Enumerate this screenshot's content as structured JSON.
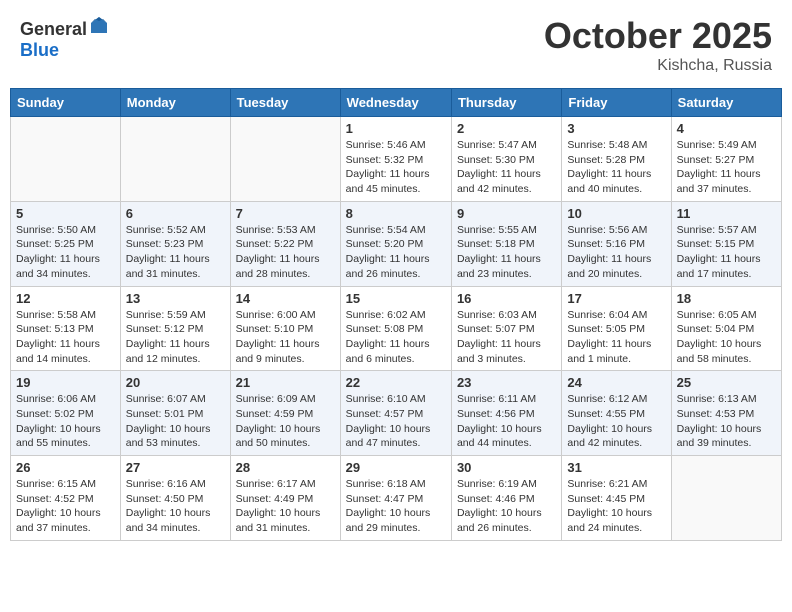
{
  "header": {
    "logo_general": "General",
    "logo_blue": "Blue",
    "month_title": "October 2025",
    "location": "Kishcha, Russia"
  },
  "columns": [
    "Sunday",
    "Monday",
    "Tuesday",
    "Wednesday",
    "Thursday",
    "Friday",
    "Saturday"
  ],
  "weeks": [
    [
      {
        "day": "",
        "sunrise": "",
        "sunset": "",
        "daylight": ""
      },
      {
        "day": "",
        "sunrise": "",
        "sunset": "",
        "daylight": ""
      },
      {
        "day": "",
        "sunrise": "",
        "sunset": "",
        "daylight": ""
      },
      {
        "day": "1",
        "sunrise": "Sunrise: 5:46 AM",
        "sunset": "Sunset: 5:32 PM",
        "daylight": "Daylight: 11 hours and 45 minutes."
      },
      {
        "day": "2",
        "sunrise": "Sunrise: 5:47 AM",
        "sunset": "Sunset: 5:30 PM",
        "daylight": "Daylight: 11 hours and 42 minutes."
      },
      {
        "day": "3",
        "sunrise": "Sunrise: 5:48 AM",
        "sunset": "Sunset: 5:28 PM",
        "daylight": "Daylight: 11 hours and 40 minutes."
      },
      {
        "day": "4",
        "sunrise": "Sunrise: 5:49 AM",
        "sunset": "Sunset: 5:27 PM",
        "daylight": "Daylight: 11 hours and 37 minutes."
      }
    ],
    [
      {
        "day": "5",
        "sunrise": "Sunrise: 5:50 AM",
        "sunset": "Sunset: 5:25 PM",
        "daylight": "Daylight: 11 hours and 34 minutes."
      },
      {
        "day": "6",
        "sunrise": "Sunrise: 5:52 AM",
        "sunset": "Sunset: 5:23 PM",
        "daylight": "Daylight: 11 hours and 31 minutes."
      },
      {
        "day": "7",
        "sunrise": "Sunrise: 5:53 AM",
        "sunset": "Sunset: 5:22 PM",
        "daylight": "Daylight: 11 hours and 28 minutes."
      },
      {
        "day": "8",
        "sunrise": "Sunrise: 5:54 AM",
        "sunset": "Sunset: 5:20 PM",
        "daylight": "Daylight: 11 hours and 26 minutes."
      },
      {
        "day": "9",
        "sunrise": "Sunrise: 5:55 AM",
        "sunset": "Sunset: 5:18 PM",
        "daylight": "Daylight: 11 hours and 23 minutes."
      },
      {
        "day": "10",
        "sunrise": "Sunrise: 5:56 AM",
        "sunset": "Sunset: 5:16 PM",
        "daylight": "Daylight: 11 hours and 20 minutes."
      },
      {
        "day": "11",
        "sunrise": "Sunrise: 5:57 AM",
        "sunset": "Sunset: 5:15 PM",
        "daylight": "Daylight: 11 hours and 17 minutes."
      }
    ],
    [
      {
        "day": "12",
        "sunrise": "Sunrise: 5:58 AM",
        "sunset": "Sunset: 5:13 PM",
        "daylight": "Daylight: 11 hours and 14 minutes."
      },
      {
        "day": "13",
        "sunrise": "Sunrise: 5:59 AM",
        "sunset": "Sunset: 5:12 PM",
        "daylight": "Daylight: 11 hours and 12 minutes."
      },
      {
        "day": "14",
        "sunrise": "Sunrise: 6:00 AM",
        "sunset": "Sunset: 5:10 PM",
        "daylight": "Daylight: 11 hours and 9 minutes."
      },
      {
        "day": "15",
        "sunrise": "Sunrise: 6:02 AM",
        "sunset": "Sunset: 5:08 PM",
        "daylight": "Daylight: 11 hours and 6 minutes."
      },
      {
        "day": "16",
        "sunrise": "Sunrise: 6:03 AM",
        "sunset": "Sunset: 5:07 PM",
        "daylight": "Daylight: 11 hours and 3 minutes."
      },
      {
        "day": "17",
        "sunrise": "Sunrise: 6:04 AM",
        "sunset": "Sunset: 5:05 PM",
        "daylight": "Daylight: 11 hours and 1 minute."
      },
      {
        "day": "18",
        "sunrise": "Sunrise: 6:05 AM",
        "sunset": "Sunset: 5:04 PM",
        "daylight": "Daylight: 10 hours and 58 minutes."
      }
    ],
    [
      {
        "day": "19",
        "sunrise": "Sunrise: 6:06 AM",
        "sunset": "Sunset: 5:02 PM",
        "daylight": "Daylight: 10 hours and 55 minutes."
      },
      {
        "day": "20",
        "sunrise": "Sunrise: 6:07 AM",
        "sunset": "Sunset: 5:01 PM",
        "daylight": "Daylight: 10 hours and 53 minutes."
      },
      {
        "day": "21",
        "sunrise": "Sunrise: 6:09 AM",
        "sunset": "Sunset: 4:59 PM",
        "daylight": "Daylight: 10 hours and 50 minutes."
      },
      {
        "day": "22",
        "sunrise": "Sunrise: 6:10 AM",
        "sunset": "Sunset: 4:57 PM",
        "daylight": "Daylight: 10 hours and 47 minutes."
      },
      {
        "day": "23",
        "sunrise": "Sunrise: 6:11 AM",
        "sunset": "Sunset: 4:56 PM",
        "daylight": "Daylight: 10 hours and 44 minutes."
      },
      {
        "day": "24",
        "sunrise": "Sunrise: 6:12 AM",
        "sunset": "Sunset: 4:55 PM",
        "daylight": "Daylight: 10 hours and 42 minutes."
      },
      {
        "day": "25",
        "sunrise": "Sunrise: 6:13 AM",
        "sunset": "Sunset: 4:53 PM",
        "daylight": "Daylight: 10 hours and 39 minutes."
      }
    ],
    [
      {
        "day": "26",
        "sunrise": "Sunrise: 6:15 AM",
        "sunset": "Sunset: 4:52 PM",
        "daylight": "Daylight: 10 hours and 37 minutes."
      },
      {
        "day": "27",
        "sunrise": "Sunrise: 6:16 AM",
        "sunset": "Sunset: 4:50 PM",
        "daylight": "Daylight: 10 hours and 34 minutes."
      },
      {
        "day": "28",
        "sunrise": "Sunrise: 6:17 AM",
        "sunset": "Sunset: 4:49 PM",
        "daylight": "Daylight: 10 hours and 31 minutes."
      },
      {
        "day": "29",
        "sunrise": "Sunrise: 6:18 AM",
        "sunset": "Sunset: 4:47 PM",
        "daylight": "Daylight: 10 hours and 29 minutes."
      },
      {
        "day": "30",
        "sunrise": "Sunrise: 6:19 AM",
        "sunset": "Sunset: 4:46 PM",
        "daylight": "Daylight: 10 hours and 26 minutes."
      },
      {
        "day": "31",
        "sunrise": "Sunrise: 6:21 AM",
        "sunset": "Sunset: 4:45 PM",
        "daylight": "Daylight: 10 hours and 24 minutes."
      },
      {
        "day": "",
        "sunrise": "",
        "sunset": "",
        "daylight": ""
      }
    ]
  ]
}
